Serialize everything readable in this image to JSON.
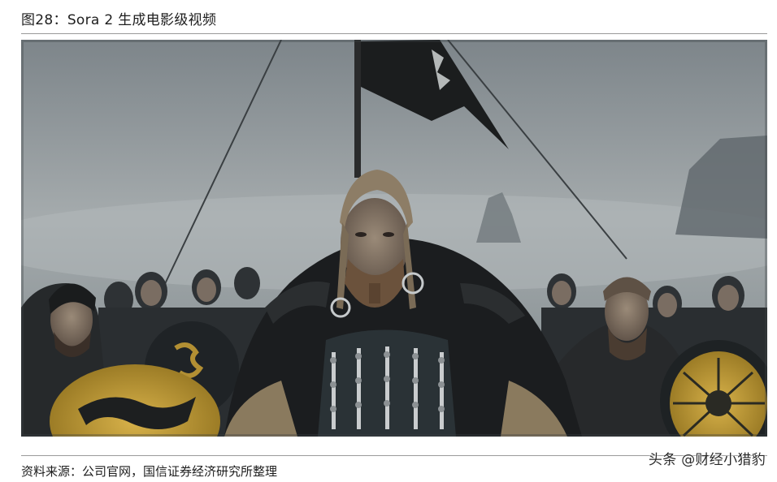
{
  "figure": {
    "title": "图28：Sora 2 生成电影级视频",
    "image_alt": "Viking warriors with round shields standing before a flag in the mist"
  },
  "footer": {
    "source": "资料来源：公司官网，国信证券经济研究所整理",
    "watermark": "头条 @财经小猎豹"
  },
  "colors": {
    "sky": "#8a9195",
    "fog": "#aeb4b6",
    "fur": "#1e2022",
    "shield_yellow": "#c9a43a"
  }
}
